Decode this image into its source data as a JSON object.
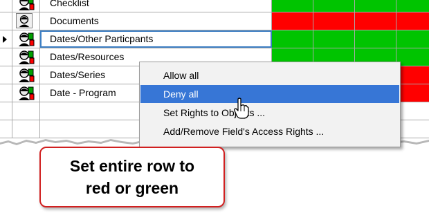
{
  "rows": [
    {
      "name": "Checklist",
      "perms": [
        "g",
        "g",
        "g",
        "g"
      ],
      "icon": "person-icon",
      "selected": false
    },
    {
      "name": "Documents",
      "perms": [
        "r",
        "r",
        "r",
        "r"
      ],
      "icon": "person-icon-boxed",
      "selected": false
    },
    {
      "name": "Dates/Other Particpants",
      "perms": [
        "g",
        "g",
        "g",
        "g"
      ],
      "icon": "person-icon",
      "selected": true
    },
    {
      "name": "Dates/Resources",
      "perms": [
        "g",
        "g",
        "g",
        "g"
      ],
      "icon": "person-icon",
      "selected": false
    },
    {
      "name": "Dates/Series",
      "perms": [
        "r",
        "r",
        "r",
        "r"
      ],
      "icon": "person-icon",
      "selected": false
    },
    {
      "name": "Date - Program",
      "perms": [
        "r",
        "r",
        "r",
        "r"
      ],
      "icon": "person-icon",
      "selected": false
    }
  ],
  "menu": {
    "items": [
      {
        "label": "Allow all",
        "highlighted": false
      },
      {
        "label": "Deny all",
        "highlighted": true
      },
      {
        "label": "Set Rights to Objects ...",
        "highlighted": false
      },
      {
        "label": "Add/Remove Field's Access Rights ...",
        "highlighted": false
      }
    ]
  },
  "callout": {
    "text": "Set entire row to red or green"
  },
  "colors": {
    "allow": "#00c400",
    "deny": "#ff0000",
    "highlight": "#3776d6",
    "callout_border": "#d12020"
  }
}
